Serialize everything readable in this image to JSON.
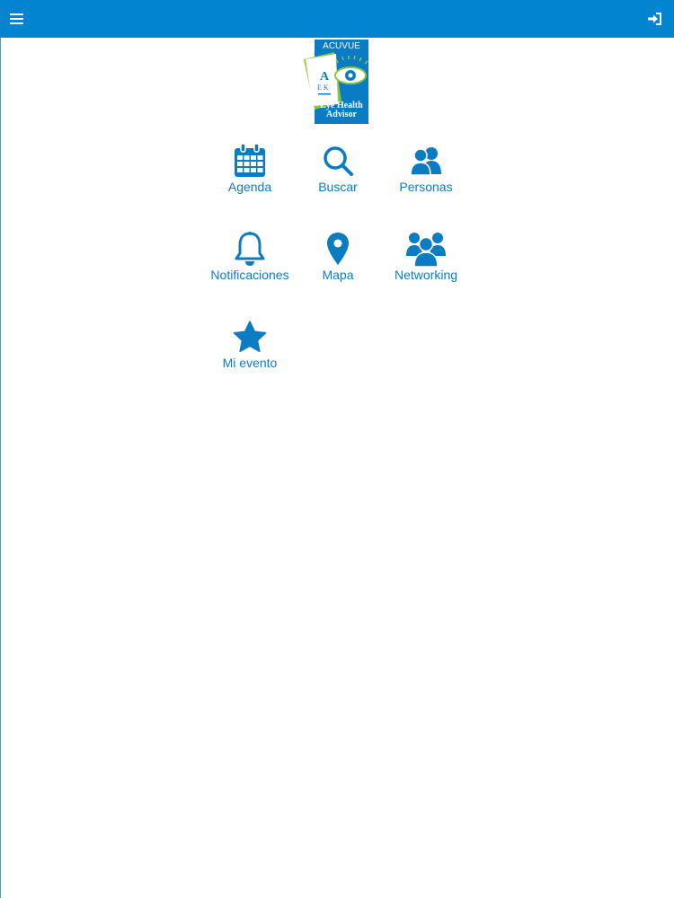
{
  "header": {
    "menu_icon": "hamburger-menu-icon",
    "login_icon": "sign-in-icon",
    "bar_color": "#0384d0"
  },
  "logo": {
    "brand": "ACUVUE",
    "line1": "Eye Health",
    "line2": "Advisor",
    "chart_letters": "A E K"
  },
  "menu": {
    "items": [
      {
        "label": "Agenda",
        "icon": "calendar-icon"
      },
      {
        "label": "Buscar",
        "icon": "search-icon"
      },
      {
        "label": "Personas",
        "icon": "people-icon"
      },
      {
        "label": "Notificaciones",
        "icon": "bell-icon"
      },
      {
        "label": "Mapa",
        "icon": "map-marker-icon"
      },
      {
        "label": "Networking",
        "icon": "group-icon"
      },
      {
        "label": "Mi evento",
        "icon": "star-icon"
      }
    ],
    "accent": "#0b7cc1"
  }
}
